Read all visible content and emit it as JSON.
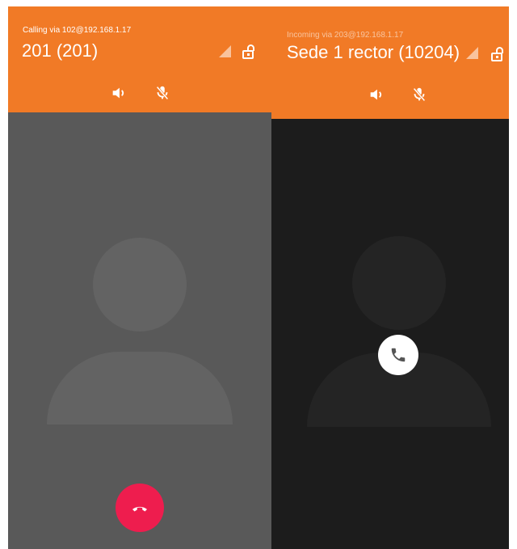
{
  "left_call": {
    "status_line": "Calling via 102@192.168.1.17",
    "caller_name": "201 (201)",
    "icons": [
      "signal-icon",
      "lock-open-icon",
      "speaker-icon",
      "mic-off-icon",
      "avatar-placeholder",
      "hangup-icon"
    ]
  },
  "right_call": {
    "status_line": "Incoming via 203@192.168.1.17",
    "caller_name": "Sede 1 rector (10204)",
    "icons": [
      "signal-icon",
      "lock-open-icon",
      "speaker-icon",
      "mic-off-icon",
      "avatar-placeholder",
      "answer-call-icon"
    ]
  },
  "colors": {
    "header": "#f17a26",
    "left_background": "#595959",
    "right_background": "#1c1c1c",
    "hangup_button": "#ee1d4e",
    "answer_button": "#ffffff"
  }
}
